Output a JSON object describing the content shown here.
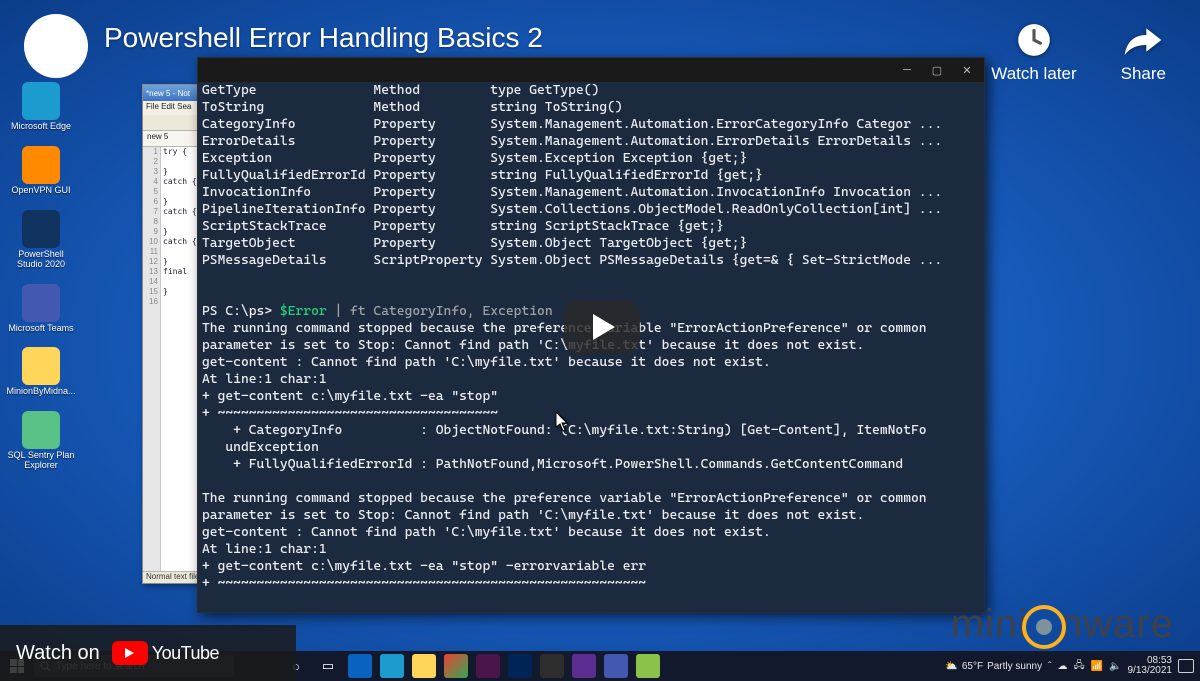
{
  "youtube": {
    "title": "Powershell Error Handling Basics 2",
    "watch_later": "Watch later",
    "share": "Share",
    "watch_on": "Watch on",
    "youtube_word": "YouTube"
  },
  "desktop": {
    "icons": [
      {
        "label": "Microsoft Edge",
        "cls": "di-edge"
      },
      {
        "label": "OpenVPN GUI",
        "cls": "di-ovpn"
      },
      {
        "label": "PowerShell Studio 2020",
        "cls": "di-pss"
      },
      {
        "label": "Microsoft Teams",
        "cls": "di-teams"
      },
      {
        "label": "MinionByMidna...",
        "cls": "di-folder"
      },
      {
        "label": "SQL Sentry Plan Explorer",
        "cls": "di-sentry"
      }
    ]
  },
  "notepad": {
    "title": "*new 5 - Not",
    "tab": "new 5",
    "status": "Normal text file",
    "lines": [
      "try {",
      "",
      "}",
      "catch {",
      "",
      "}",
      "catch {",
      "",
      "}",
      "catch {",
      "",
      "}",
      "final",
      "",
      "}",
      ""
    ]
  },
  "terminal": {
    "rows": [
      {
        "c1": "GetType",
        "c2": "Method",
        "c3": "type GetType()"
      },
      {
        "c1": "ToString",
        "c2": "Method",
        "c3": "string ToString()"
      },
      {
        "c1": "CategoryInfo",
        "c2": "Property",
        "c3": "System.Management.Automation.ErrorCategoryInfo Categor ..."
      },
      {
        "c1": "ErrorDetails",
        "c2": "Property",
        "c3": "System.Management.Automation.ErrorDetails ErrorDetails ..."
      },
      {
        "c1": "Exception",
        "c2": "Property",
        "c3": "System.Exception Exception {get;}"
      },
      {
        "c1": "FullyQualifiedErrorId",
        "c2": "Property",
        "c3": "string FullyQualifiedErrorId {get;}"
      },
      {
        "c1": "InvocationInfo",
        "c2": "Property",
        "c3": "System.Management.Automation.InvocationInfo Invocation ..."
      },
      {
        "c1": "PipelineIterationInfo",
        "c2": "Property",
        "c3": "System.Collections.ObjectModel.ReadOnlyCollection[int] ..."
      },
      {
        "c1": "ScriptStackTrace",
        "c2": "Property",
        "c3": "string ScriptStackTrace {get;}"
      },
      {
        "c1": "TargetObject",
        "c2": "Property",
        "c3": "System.Object TargetObject {get;}"
      },
      {
        "c1": "PSMessageDetails",
        "c2": "ScriptProperty",
        "c3": "System.Object PSMessageDetails {get=& { Set-StrictMode ..."
      }
    ],
    "prompt_prefix": "PS C:\\ps> ",
    "prompt_cmd_var": "$Error",
    "prompt_cmd_rest": " | ft CategoryInfo, Exception",
    "err_block1_l1": "The running command stopped because the preference variable \"ErrorActionPreference\" or common",
    "err_block1_l2": "parameter is set to Stop: Cannot find path 'C:\\myfile.txt' because it does not exist.",
    "err_gc": "get-content : Cannot find path 'C:\\myfile.txt' because it does not exist.",
    "err_at": "At line:1 char:1",
    "err_cmd1": "+ get-content c:\\myfile.txt -ea \"stop\"",
    "err_tilde": "+ ~~~~~~~~~~~~~~~~~~~~~~~~~~~~~~~~~~~~",
    "err_catinfo": "    + CategoryInfo          : ObjectNotFound: (C:\\myfile.txt:String) [Get-Content], ItemNotFo",
    "err_catinfo2": "   undException",
    "err_fqi": "    + FullyQualifiedErrorId : PathNotFound,Microsoft.PowerShell.Commands.GetContentCommand",
    "err_cmd2": "+ get-content c:\\myfile.txt -ea \"stop\" -errorvariable err",
    "err_tilde2": "+ ~~~~~~~~~~~~~~~~~~~~~~~~~~~~~~~~~~~~~~~~~~~~~~~~~~~~~~~"
  },
  "branding": {
    "pre": "mini",
    "post": "nware"
  },
  "taskbar": {
    "search_placeholder": "Type here to search",
    "weather_temp": "65°F",
    "weather_cond": "Partly sunny",
    "time": "08:53",
    "date": "9/13/2021"
  }
}
